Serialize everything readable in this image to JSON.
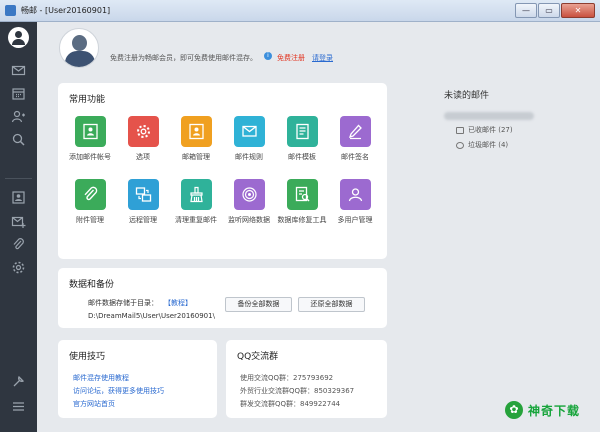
{
  "window": {
    "title": "畅邮 - [User20160901]",
    "controls": [
      "—",
      "▭",
      "✕"
    ]
  },
  "nav": {
    "icons": [
      "avatar-icon",
      "mail-icon",
      "calendar-icon",
      "contacts-icon",
      "search-icon",
      "profile-icon",
      "compose-icon",
      "attachment-icon",
      "settings-icon",
      "tools-icon",
      "menu-icon"
    ]
  },
  "banner": {
    "text": "免费注册为畅邮会员，即可免费使用邮件混存。",
    "register": "免费注册",
    "login": "请登录"
  },
  "common": {
    "title": "常用功能",
    "items": [
      {
        "label": "添加邮件帐号",
        "color": "#3bab5a",
        "icon": "add-account-icon"
      },
      {
        "label": "选项",
        "color": "#e5534b",
        "icon": "options-icon"
      },
      {
        "label": "邮箱管理",
        "color": "#f0a020",
        "icon": "mailbox-manage-icon"
      },
      {
        "label": "邮件规则",
        "color": "#2fb2d6",
        "icon": "mail-rules-icon"
      },
      {
        "label": "邮件模板",
        "color": "#2fb29a",
        "icon": "mail-template-icon"
      },
      {
        "label": "邮件签名",
        "color": "#9c6ad0",
        "icon": "signature-icon"
      },
      {
        "label": "附件管理",
        "color": "#3bab5a",
        "icon": "attachment-icon"
      },
      {
        "label": "远程管理",
        "color": "#2fa0d6",
        "icon": "remote-manage-icon"
      },
      {
        "label": "清理重复邮件",
        "color": "#2fb29a",
        "icon": "clean-duplicates-icon"
      },
      {
        "label": "监听网络数据",
        "color": "#9c6ad0",
        "icon": "monitor-icon"
      },
      {
        "label": "数据库修复工具",
        "color": "#3bab5a",
        "icon": "db-repair-icon"
      },
      {
        "label": "多用户管理",
        "color": "#9c6ad0",
        "icon": "multi-user-icon"
      }
    ]
  },
  "backup": {
    "title": "数据和备份",
    "label": "邮件数据存储于目录：",
    "tutorial": "【教程】",
    "path": "D:\\DreamMail5\\User\\User20160901\\",
    "backup_btn": "备份全部数据",
    "restore_btn": "还原全部数据"
  },
  "tips": {
    "title": "使用技巧",
    "links": [
      "邮件混存使用教程",
      "访问论坛，获得更多使用技巧",
      "官方网站首页"
    ]
  },
  "qq": {
    "title": "QQ交流群",
    "lines": [
      "使用交流QQ群：275793692",
      "外贸行业交流群QQ群：850329367",
      "群发交流群QQ群：849922744"
    ]
  },
  "unread": {
    "title": "未读的邮件",
    "received": "已收邮件 (27)",
    "junk": "垃圾邮件 (4)"
  },
  "watermark": {
    "text": "神奇下载"
  }
}
